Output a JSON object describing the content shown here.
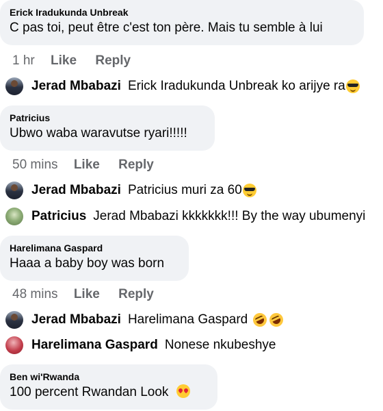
{
  "comments": [
    {
      "author": "Erick Iradukunda Unbreak",
      "text": "C pas toi, peut être c'est ton père. Mais tu semble à lui",
      "time": "1 hr",
      "like": "Like",
      "reply": "Reply",
      "replies": [
        {
          "name": "Jerad Mbabazi",
          "text": "Erick Iradukunda Unbreak  ko arijye ra",
          "emoji": "smiling-face-sunglasses-icon"
        }
      ]
    },
    {
      "author": "Patricius",
      "text": "Ubwo waba waravutse ryari!!!!!",
      "time": "50 mins",
      "like": "Like",
      "reply": "Reply",
      "replies": [
        {
          "name": "Jerad Mbabazi",
          "text": "Patricius muri za 60",
          "emoji": "smiling-face-sunglasses-icon"
        },
        {
          "name": "Patricius",
          "text": "Jerad Mbabazi kkkkkkk!!! By the way ubumenyi"
        }
      ]
    },
    {
      "author": "Harelimana Gaspard",
      "text": "Haaa a baby boy was born",
      "time": "48 mins",
      "like": "Like",
      "reply": "Reply",
      "replies": [
        {
          "name": "Jerad Mbabazi",
          "text": "Harelimana Gaspard",
          "emoji": "rolling-laughing-icon"
        },
        {
          "name": "Harelimana Gaspard",
          "text": "Nonese nkubeshye"
        }
      ]
    },
    {
      "author": "Ben wi'Rwanda",
      "text": "100 percent Rwandan Look",
      "emoji": "heart-eyes-icon"
    }
  ],
  "colors": {
    "bubble": "#f0f2f5",
    "meta": "#65676b",
    "text": "#050505"
  }
}
